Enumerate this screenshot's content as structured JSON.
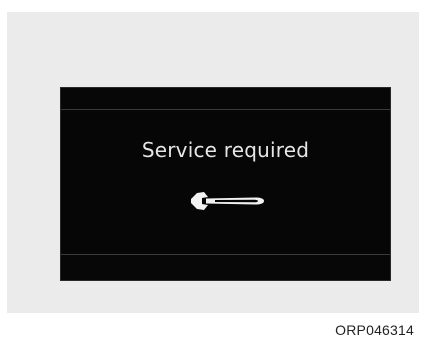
{
  "display": {
    "message": "Service required",
    "icon": "wrench-icon"
  },
  "figure_code": "ORP046314",
  "colors": {
    "frame_background": "#ebebeb",
    "display_background": "#060606",
    "message_text": "#e6e6e6"
  }
}
